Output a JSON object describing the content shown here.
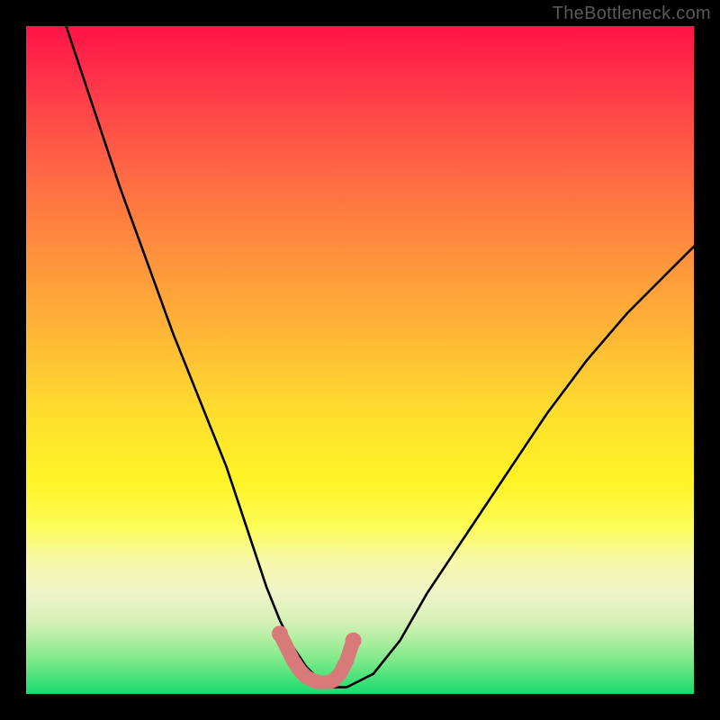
{
  "watermark": {
    "text": "TheBottleneck.com"
  },
  "chart_data": {
    "type": "line",
    "title": "",
    "xlabel": "",
    "ylabel": "",
    "xlim": [
      0,
      100
    ],
    "ylim": [
      0,
      100
    ],
    "grid": false,
    "legend": false,
    "series": [
      {
        "name": "bottleneck-curve",
        "color": "#000000",
        "x": [
          6,
          10,
          14,
          18,
          22,
          26,
          30,
          34,
          36,
          38,
          40,
          42,
          44,
          46,
          48,
          52,
          56,
          60,
          66,
          72,
          78,
          84,
          90,
          96,
          100
        ],
        "y": [
          100,
          88,
          76,
          65,
          54,
          44,
          34,
          22,
          16,
          11,
          7,
          4,
          2,
          1,
          1,
          3,
          8,
          15,
          24,
          33,
          42,
          50,
          57,
          63,
          67
        ]
      },
      {
        "name": "optimal-zone-marker",
        "color": "#d77a79",
        "x": [
          38,
          39,
          40,
          41,
          42,
          43,
          44,
          45,
          46,
          47,
          48,
          49
        ],
        "y": [
          9,
          7,
          5,
          3.5,
          2.5,
          2,
          1.7,
          1.7,
          2,
          3,
          5,
          8
        ]
      }
    ],
    "background_gradient": {
      "top": "#ff1346",
      "upper_mid": "#ffde2e",
      "lower_mid": "#f7f8a8",
      "bottom": "#16dd70"
    }
  }
}
